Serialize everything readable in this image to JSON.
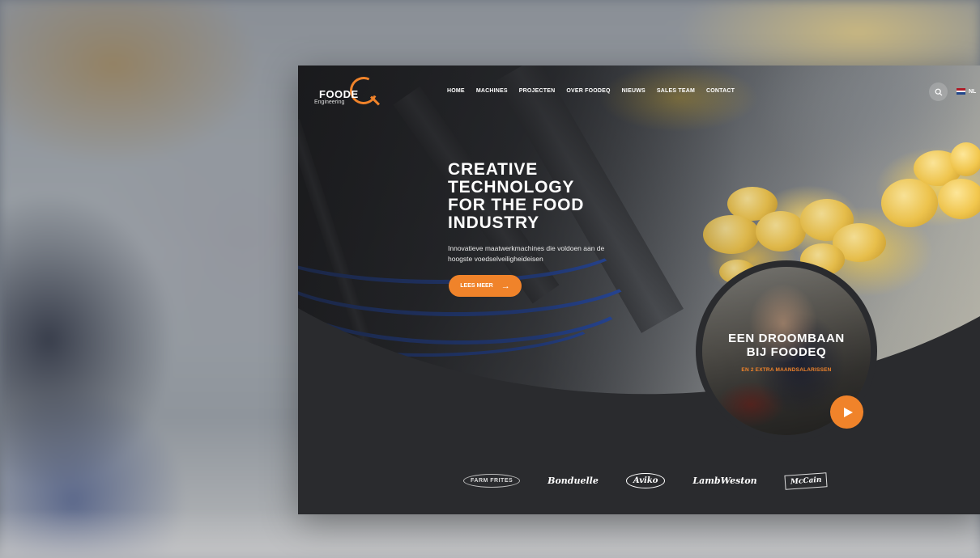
{
  "logo": {
    "text": "FOODE",
    "subtext": "Engineering"
  },
  "nav": {
    "items": [
      "HOME",
      "MACHINES",
      "PROJECTEN",
      "OVER FOODEQ",
      "NIEUWS",
      "SALES TEAM",
      "CONTACT"
    ]
  },
  "header": {
    "language": "NL"
  },
  "hero": {
    "title": "CREATIVE\nTECHNOLOGY\nFOR THE FOOD\nINDUSTRY",
    "subtitle": "Innovatieve maatwerkmachines die voldoen aan de hoogste voedselveiligheideisen",
    "cta_label": "LEES MEER"
  },
  "video_card": {
    "title": "EEN DROOMBAAN\nBIJ FOODEQ",
    "subtitle": "EN 2 EXTRA MAANDSALARISSEN"
  },
  "clients": [
    "FARM FRITES",
    "Bonduelle",
    "Aviko",
    "LambWeston",
    "McCain"
  ],
  "colors": {
    "accent": "#f0832a",
    "dark": "#2a2b2e",
    "text": "#ffffff"
  },
  "icons": [
    "search-icon",
    "nl-flag-icon",
    "arrow-right-icon",
    "play-icon"
  ]
}
